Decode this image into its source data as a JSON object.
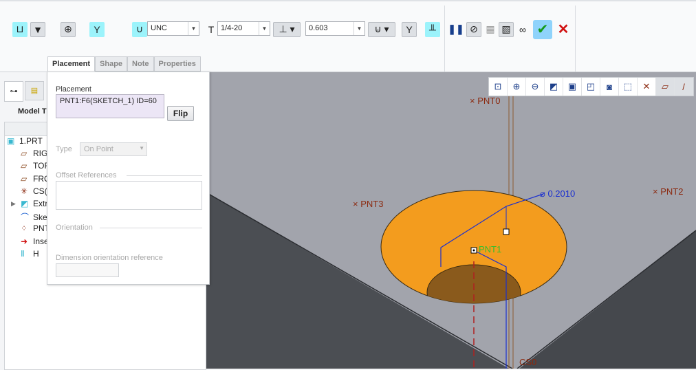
{
  "ribbon": {
    "thread_standard": "UNC",
    "screw_size": "1/4-20",
    "depth_value": "0.603",
    "tabs": [
      "Placement",
      "Shape",
      "Note",
      "Properties"
    ],
    "icons": [
      "simple-hole-icon",
      "standard-hole-icon",
      "placement-icon",
      "drill-icon",
      "tapered-thread-icon",
      "screw-size-icon",
      "depth-icon",
      "depth-option-icon",
      "countersink-icon",
      "counterbore-icon",
      "pause-icon",
      "no-preview-icon",
      "preview-geometry-icon",
      "verify-icon",
      "glasses-icon",
      "ok-icon",
      "cancel-icon"
    ]
  },
  "sidebar": {
    "header": "Model T",
    "items": [
      {
        "label": "1.PRT",
        "icon": "part-icon"
      },
      {
        "label": "RIG",
        "icon": "datum-plane-icon"
      },
      {
        "label": "TOF",
        "icon": "datum-plane-icon"
      },
      {
        "label": "FRO",
        "icon": "datum-plane-icon"
      },
      {
        "label": "CS(",
        "icon": "csys-icon"
      },
      {
        "label": "Extr",
        "icon": "extrude-icon"
      },
      {
        "label": "Ske",
        "icon": "sketch-icon"
      },
      {
        "label": "PNT",
        "icon": "datum-point-icon"
      },
      {
        "label": "Inse",
        "icon": "insert-here-icon"
      },
      {
        "label": "H",
        "icon": "hole-icon"
      }
    ]
  },
  "placement_panel": {
    "title": "Placement",
    "reference": "PNT1:F6(SKETCH_1) ID=60",
    "flip": "Flip",
    "type_label": "Type",
    "type_value": "On Point",
    "offset_refs": "Offset References",
    "orientation": "Orientation",
    "dim_orient": "Dimension orientation reference"
  },
  "viewport": {
    "labels": {
      "pnt0": "PNT0",
      "pnt1": "PNT1",
      "pnt2": "PNT2",
      "pnt3": "PNT3",
      "cs0": "CS0",
      "diameter": "0.2010"
    },
    "colors": {
      "top_face": "#a2a4ac",
      "side_face": "#4b4e53",
      "hole": "#f39c1e",
      "hole_bottom": "#8a5a1c",
      "dimension": "#1a2fd0",
      "point": "#8b2a10"
    }
  }
}
